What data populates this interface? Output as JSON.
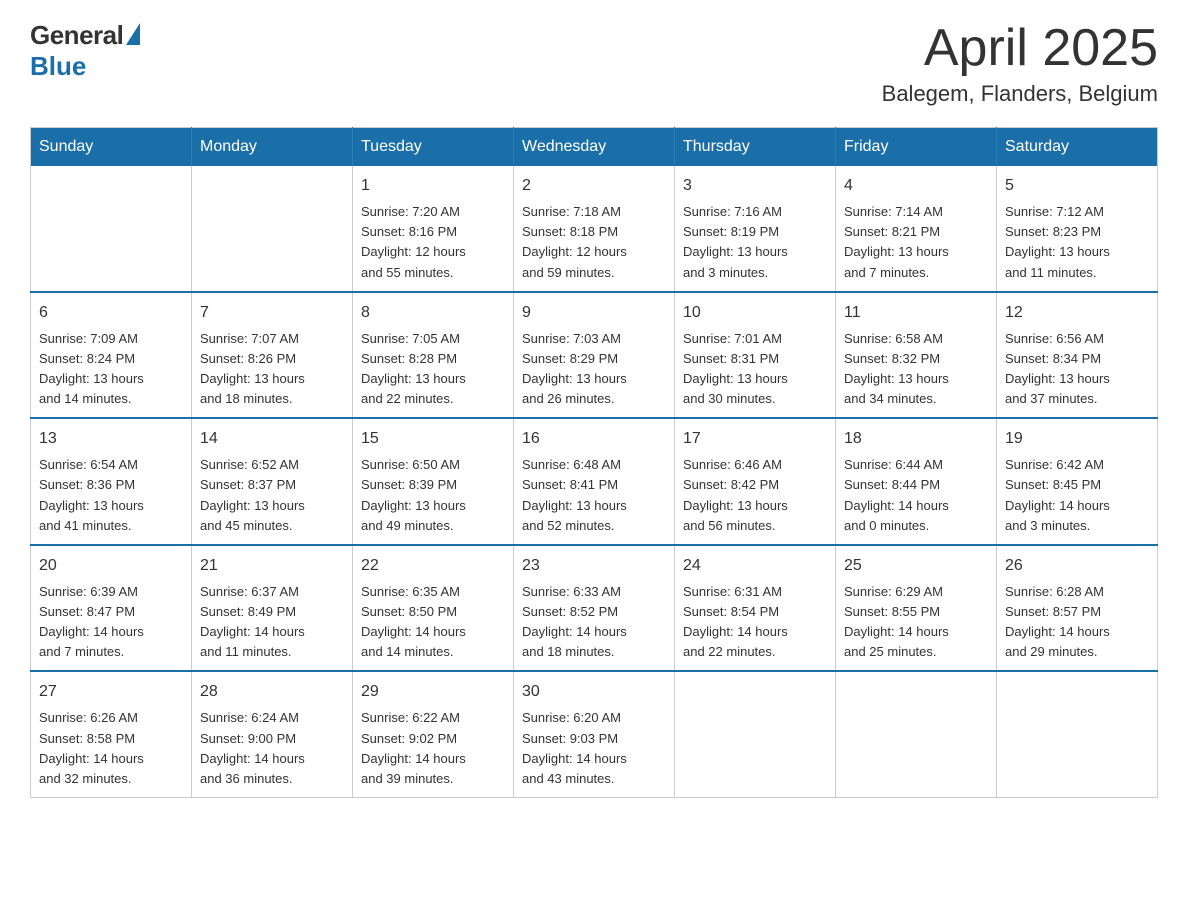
{
  "logo": {
    "general": "General",
    "blue": "Blue"
  },
  "header": {
    "month": "April 2025",
    "location": "Balegem, Flanders, Belgium"
  },
  "weekdays": [
    "Sunday",
    "Monday",
    "Tuesday",
    "Wednesday",
    "Thursday",
    "Friday",
    "Saturday"
  ],
  "weeks": [
    [
      {
        "day": "",
        "info": ""
      },
      {
        "day": "",
        "info": ""
      },
      {
        "day": "1",
        "info": "Sunrise: 7:20 AM\nSunset: 8:16 PM\nDaylight: 12 hours\nand 55 minutes."
      },
      {
        "day": "2",
        "info": "Sunrise: 7:18 AM\nSunset: 8:18 PM\nDaylight: 12 hours\nand 59 minutes."
      },
      {
        "day": "3",
        "info": "Sunrise: 7:16 AM\nSunset: 8:19 PM\nDaylight: 13 hours\nand 3 minutes."
      },
      {
        "day": "4",
        "info": "Sunrise: 7:14 AM\nSunset: 8:21 PM\nDaylight: 13 hours\nand 7 minutes."
      },
      {
        "day": "5",
        "info": "Sunrise: 7:12 AM\nSunset: 8:23 PM\nDaylight: 13 hours\nand 11 minutes."
      }
    ],
    [
      {
        "day": "6",
        "info": "Sunrise: 7:09 AM\nSunset: 8:24 PM\nDaylight: 13 hours\nand 14 minutes."
      },
      {
        "day": "7",
        "info": "Sunrise: 7:07 AM\nSunset: 8:26 PM\nDaylight: 13 hours\nand 18 minutes."
      },
      {
        "day": "8",
        "info": "Sunrise: 7:05 AM\nSunset: 8:28 PM\nDaylight: 13 hours\nand 22 minutes."
      },
      {
        "day": "9",
        "info": "Sunrise: 7:03 AM\nSunset: 8:29 PM\nDaylight: 13 hours\nand 26 minutes."
      },
      {
        "day": "10",
        "info": "Sunrise: 7:01 AM\nSunset: 8:31 PM\nDaylight: 13 hours\nand 30 minutes."
      },
      {
        "day": "11",
        "info": "Sunrise: 6:58 AM\nSunset: 8:32 PM\nDaylight: 13 hours\nand 34 minutes."
      },
      {
        "day": "12",
        "info": "Sunrise: 6:56 AM\nSunset: 8:34 PM\nDaylight: 13 hours\nand 37 minutes."
      }
    ],
    [
      {
        "day": "13",
        "info": "Sunrise: 6:54 AM\nSunset: 8:36 PM\nDaylight: 13 hours\nand 41 minutes."
      },
      {
        "day": "14",
        "info": "Sunrise: 6:52 AM\nSunset: 8:37 PM\nDaylight: 13 hours\nand 45 minutes."
      },
      {
        "day": "15",
        "info": "Sunrise: 6:50 AM\nSunset: 8:39 PM\nDaylight: 13 hours\nand 49 minutes."
      },
      {
        "day": "16",
        "info": "Sunrise: 6:48 AM\nSunset: 8:41 PM\nDaylight: 13 hours\nand 52 minutes."
      },
      {
        "day": "17",
        "info": "Sunrise: 6:46 AM\nSunset: 8:42 PM\nDaylight: 13 hours\nand 56 minutes."
      },
      {
        "day": "18",
        "info": "Sunrise: 6:44 AM\nSunset: 8:44 PM\nDaylight: 14 hours\nand 0 minutes."
      },
      {
        "day": "19",
        "info": "Sunrise: 6:42 AM\nSunset: 8:45 PM\nDaylight: 14 hours\nand 3 minutes."
      }
    ],
    [
      {
        "day": "20",
        "info": "Sunrise: 6:39 AM\nSunset: 8:47 PM\nDaylight: 14 hours\nand 7 minutes."
      },
      {
        "day": "21",
        "info": "Sunrise: 6:37 AM\nSunset: 8:49 PM\nDaylight: 14 hours\nand 11 minutes."
      },
      {
        "day": "22",
        "info": "Sunrise: 6:35 AM\nSunset: 8:50 PM\nDaylight: 14 hours\nand 14 minutes."
      },
      {
        "day": "23",
        "info": "Sunrise: 6:33 AM\nSunset: 8:52 PM\nDaylight: 14 hours\nand 18 minutes."
      },
      {
        "day": "24",
        "info": "Sunrise: 6:31 AM\nSunset: 8:54 PM\nDaylight: 14 hours\nand 22 minutes."
      },
      {
        "day": "25",
        "info": "Sunrise: 6:29 AM\nSunset: 8:55 PM\nDaylight: 14 hours\nand 25 minutes."
      },
      {
        "day": "26",
        "info": "Sunrise: 6:28 AM\nSunset: 8:57 PM\nDaylight: 14 hours\nand 29 minutes."
      }
    ],
    [
      {
        "day": "27",
        "info": "Sunrise: 6:26 AM\nSunset: 8:58 PM\nDaylight: 14 hours\nand 32 minutes."
      },
      {
        "day": "28",
        "info": "Sunrise: 6:24 AM\nSunset: 9:00 PM\nDaylight: 14 hours\nand 36 minutes."
      },
      {
        "day": "29",
        "info": "Sunrise: 6:22 AM\nSunset: 9:02 PM\nDaylight: 14 hours\nand 39 minutes."
      },
      {
        "day": "30",
        "info": "Sunrise: 6:20 AM\nSunset: 9:03 PM\nDaylight: 14 hours\nand 43 minutes."
      },
      {
        "day": "",
        "info": ""
      },
      {
        "day": "",
        "info": ""
      },
      {
        "day": "",
        "info": ""
      }
    ]
  ]
}
